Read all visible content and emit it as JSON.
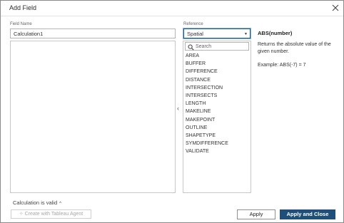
{
  "dialog": {
    "title": "Add Field"
  },
  "field": {
    "label": "Field Name",
    "value": "Calculation1"
  },
  "reference": {
    "label": "Reference",
    "selected": "Spatial",
    "search_placeholder": "Search",
    "items": [
      "AREA",
      "BUFFER",
      "DIFFERENCE",
      "DISTANCE",
      "INTERSECTION",
      "INTERSECTS",
      "LENGTH",
      "MAKELINE",
      "MAKEPOINT",
      "OUTLINE",
      "SHAPETYPE",
      "SYMDIFFERENCE",
      "VALIDATE"
    ]
  },
  "help": {
    "title": "ABS(number)",
    "description": "Returns the absolute value of the given number.",
    "example": "Example: ABS(-7) = 7"
  },
  "status": {
    "text": "Calculation is valid"
  },
  "buttons": {
    "agent": "Create with Tableau Agent",
    "apply": "Apply",
    "apply_close": "Apply and Close"
  },
  "colors": {
    "primary": "#1f4e79",
    "focus": "#1f5f8b"
  }
}
